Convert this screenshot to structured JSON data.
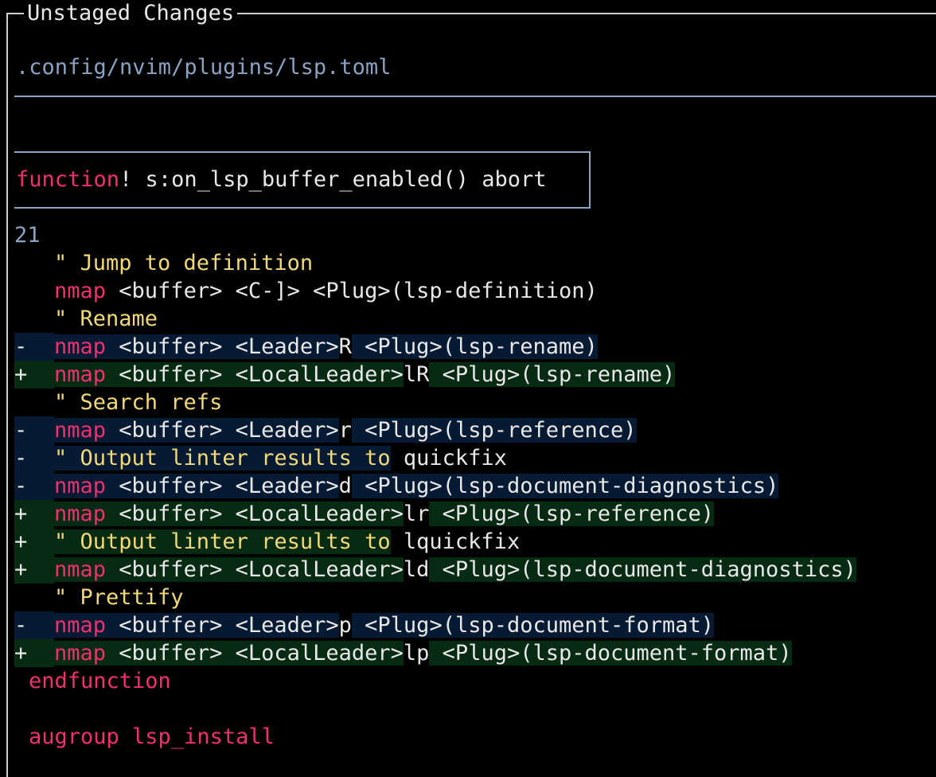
{
  "panel": {
    "title": "Unstaged Changes"
  },
  "file": {
    "path": ".config/nvim/plugins/lsp.toml"
  },
  "hunk": {
    "keyword": "function",
    "rest": "! s:on_lsp_buffer_enabled() abort"
  },
  "diff": {
    "line_number": "21",
    "lines": [
      {
        "type": "ctx",
        "marker": " ",
        "indent": "  ",
        "kind": "comment",
        "parts": [
          {
            "text": "\" Jump to definition",
            "cls": "cmt"
          }
        ]
      },
      {
        "type": "ctx",
        "marker": " ",
        "indent": "  ",
        "kind": "code",
        "parts": [
          {
            "text": "nmap",
            "cls": "kw"
          },
          {
            "text": " <buffer> <C-]> <Plug>(lsp-definition)",
            "cls": "txt"
          }
        ]
      },
      {
        "type": "ctx",
        "marker": " ",
        "indent": "  ",
        "kind": "comment",
        "parts": [
          {
            "text": "\" Rename",
            "cls": "cmt"
          }
        ]
      },
      {
        "type": "del",
        "marker": "-",
        "indent": "  ",
        "parts": [
          {
            "text": "nmap",
            "cls": "kw"
          },
          {
            "text": " <buffer> <Leader>",
            "cls": "txt"
          },
          {
            "text": "R",
            "cls": "txt",
            "plain": true
          },
          {
            "text": " <Plug>(lsp-rename)",
            "cls": "txt"
          }
        ]
      },
      {
        "type": "add",
        "marker": "+",
        "indent": "  ",
        "parts": [
          {
            "text": "nmap",
            "cls": "kw"
          },
          {
            "text": " <buffer> <LocalLeader>",
            "cls": "txt"
          },
          {
            "text": "lR",
            "cls": "txt",
            "plain": true
          },
          {
            "text": " <Plug>(lsp-rename)",
            "cls": "txt"
          }
        ]
      },
      {
        "type": "ctx",
        "marker": " ",
        "indent": "  ",
        "kind": "comment",
        "parts": [
          {
            "text": "\" Search refs",
            "cls": "cmt"
          }
        ]
      },
      {
        "type": "del",
        "marker": "-",
        "indent": "  ",
        "parts": [
          {
            "text": "nmap",
            "cls": "kw"
          },
          {
            "text": " <buffer> <Leader>",
            "cls": "txt"
          },
          {
            "text": "r",
            "cls": "txt",
            "plain": true
          },
          {
            "text": " <Plug>(lsp-reference)",
            "cls": "txt"
          }
        ]
      },
      {
        "type": "del",
        "marker": "-",
        "indent": "  ",
        "parts": [
          {
            "text": "\" Output linter results to",
            "cls": "cmt"
          },
          {
            "text": " quickfix",
            "cls": "txt",
            "plain": true
          }
        ]
      },
      {
        "type": "del",
        "marker": "-",
        "indent": "  ",
        "parts": [
          {
            "text": "nmap",
            "cls": "kw"
          },
          {
            "text": " <buffer> <Leader>",
            "cls": "txt"
          },
          {
            "text": "d",
            "cls": "txt",
            "plain": true
          },
          {
            "text": " <Plug>(lsp-document-diagnostics)",
            "cls": "txt"
          }
        ]
      },
      {
        "type": "add",
        "marker": "+",
        "indent": "  ",
        "parts": [
          {
            "text": "nmap",
            "cls": "kw"
          },
          {
            "text": " <buffer> <LocalLeader>",
            "cls": "txt"
          },
          {
            "text": "lr",
            "cls": "txt",
            "plain": true
          },
          {
            "text": " <Plug>(lsp-reference)",
            "cls": "txt"
          }
        ]
      },
      {
        "type": "add",
        "marker": "+",
        "indent": "  ",
        "parts": [
          {
            "text": "\" Output linter results to",
            "cls": "cmt"
          },
          {
            "text": " lquickfix",
            "cls": "txt",
            "plain": true
          }
        ]
      },
      {
        "type": "add",
        "marker": "+",
        "indent": "  ",
        "parts": [
          {
            "text": "nmap",
            "cls": "kw"
          },
          {
            "text": " <buffer> <LocalLeader>",
            "cls": "txt"
          },
          {
            "text": "ld",
            "cls": "txt",
            "plain": true
          },
          {
            "text": " <Plug>(lsp-document-diagnostics)",
            "cls": "txt"
          }
        ]
      },
      {
        "type": "ctx",
        "marker": " ",
        "indent": "  ",
        "kind": "comment",
        "parts": [
          {
            "text": "\" Prettify",
            "cls": "cmt"
          }
        ]
      },
      {
        "type": "del",
        "marker": "-",
        "indent": "  ",
        "parts": [
          {
            "text": "nmap",
            "cls": "kw"
          },
          {
            "text": " <buffer> <Leader>",
            "cls": "txt"
          },
          {
            "text": "p",
            "cls": "txt",
            "plain": true
          },
          {
            "text": " <Plug>(lsp-document-format)",
            "cls": "txt"
          }
        ]
      },
      {
        "type": "add",
        "marker": "+",
        "indent": "  ",
        "parts": [
          {
            "text": "nmap",
            "cls": "kw"
          },
          {
            "text": " <buffer> <LocalLeader>",
            "cls": "txt"
          },
          {
            "text": "lp",
            "cls": "txt",
            "plain": true
          },
          {
            "text": " <Plug>(lsp-document-format)",
            "cls": "txt"
          }
        ]
      },
      {
        "type": "ctx",
        "marker": "",
        "indent": "",
        "kind": "code",
        "parts": [
          {
            "text": "endfunction",
            "cls": "kw"
          }
        ]
      },
      {
        "type": "blank",
        "marker": "",
        "indent": "",
        "parts": []
      },
      {
        "type": "ctx",
        "marker": "",
        "indent": "",
        "kind": "code",
        "parts": [
          {
            "text": "augroup lsp_install",
            "cls": "kw"
          }
        ]
      }
    ]
  },
  "colors": {
    "keyword": "#f0306f",
    "comment": "#f1d97a",
    "path": "#8aa3c2",
    "deleted_bg": "#061b33",
    "added_bg": "#062a12"
  }
}
